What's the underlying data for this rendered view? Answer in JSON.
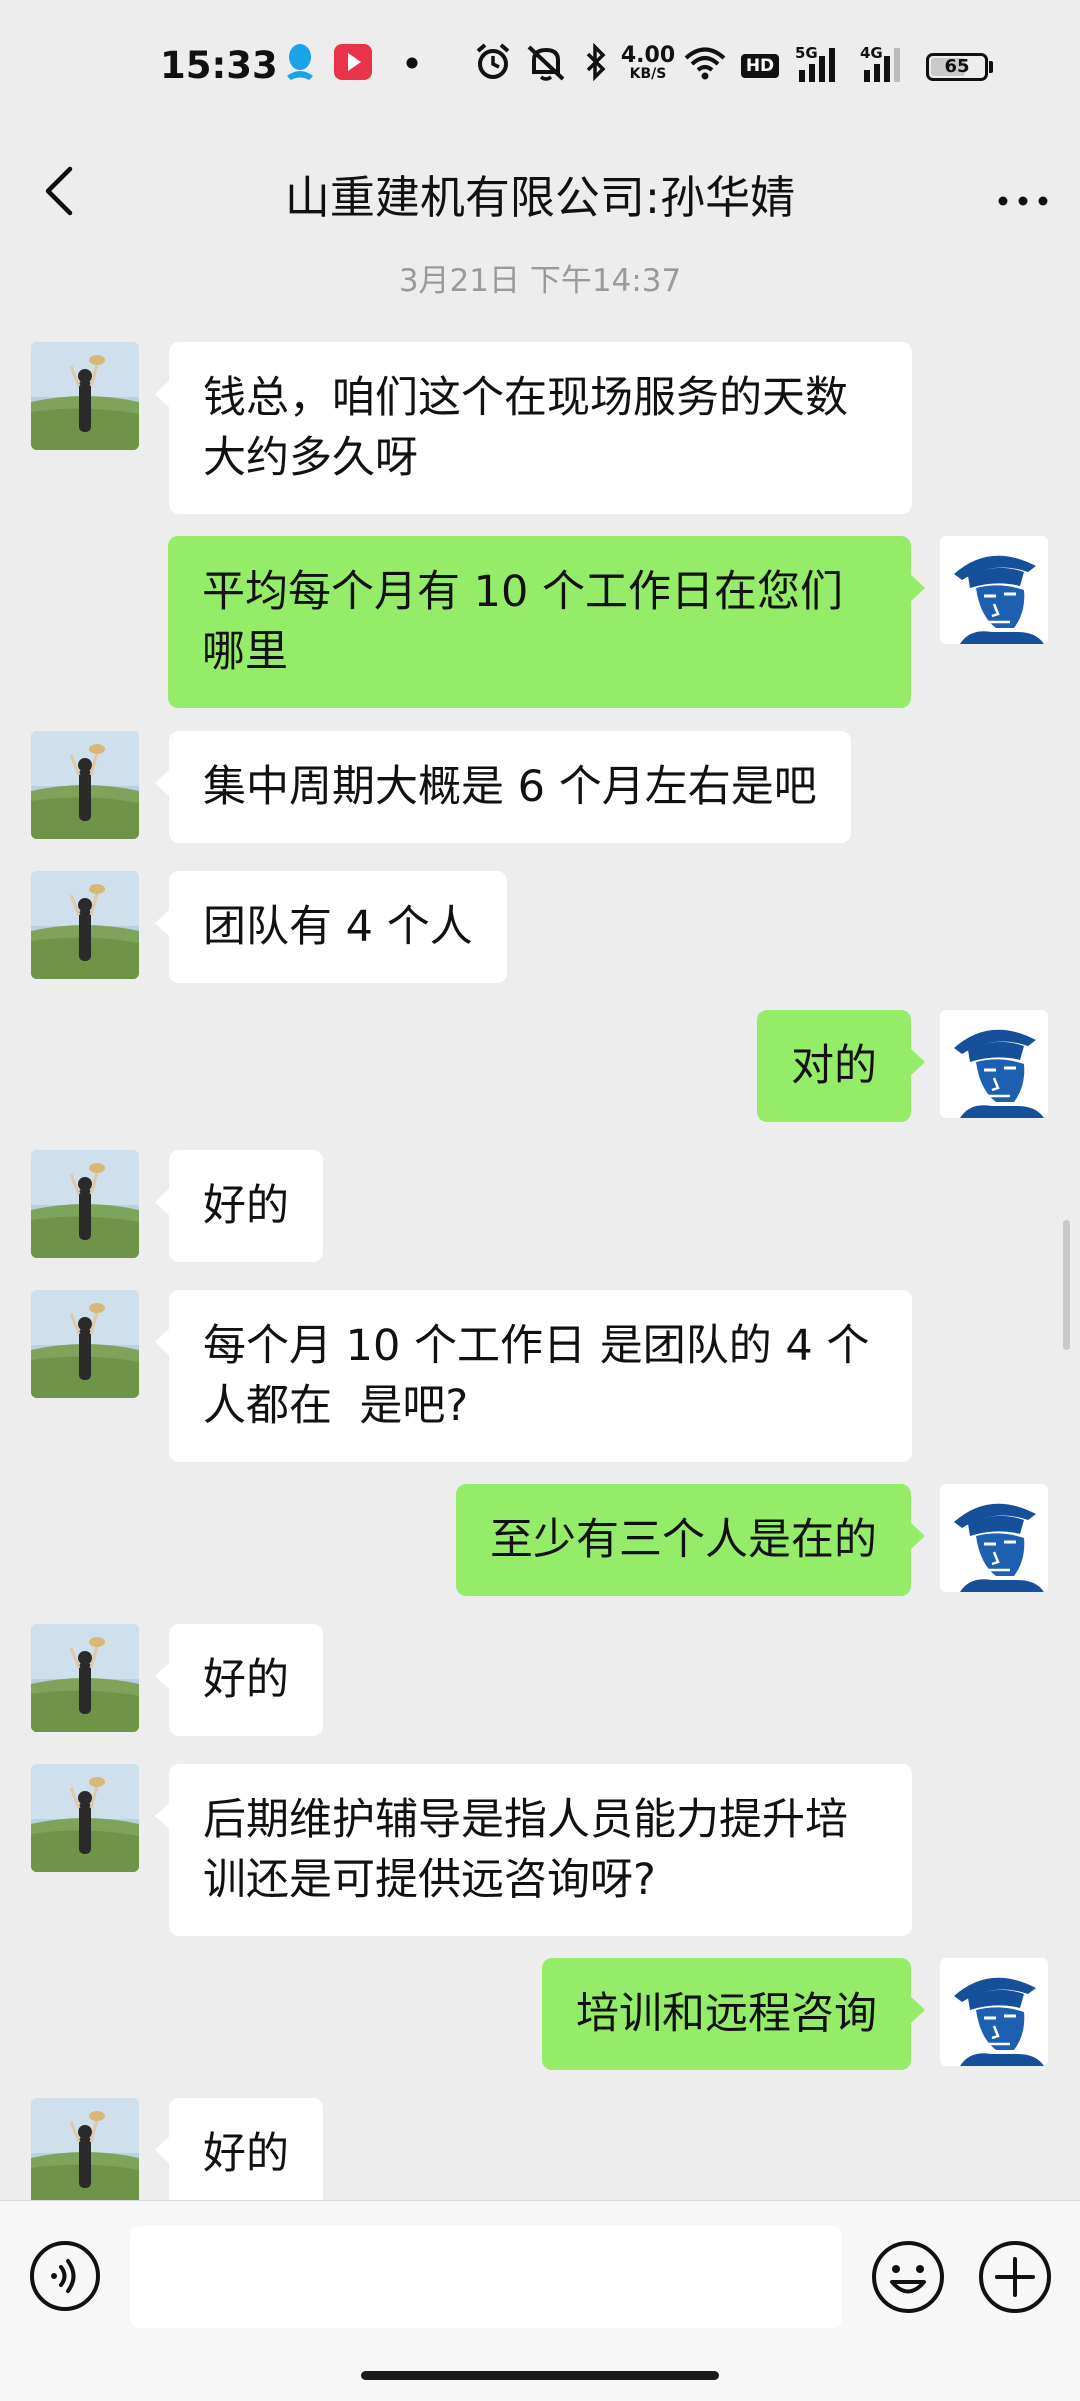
{
  "status_bar": {
    "time": "15:33",
    "net_speed_value": "4.00",
    "net_speed_unit": "KB/S",
    "hd_label": "HD",
    "signal1_label": "5G",
    "signal2_label": "4G",
    "battery_level": "65"
  },
  "header": {
    "title": "山重建机有限公司:孙华婧"
  },
  "timestamp": "3月21日 下午14:37",
  "messages": [
    {
      "side": "in",
      "text": "钱总，咱们这个在现场服务的天数大约多久呀"
    },
    {
      "side": "out",
      "text": "平均每个月有 10 个工作日在您们哪里"
    },
    {
      "side": "in",
      "text": "集中周期大概是 6 个月左右是吧"
    },
    {
      "side": "in",
      "text": "团队有 4 个人"
    },
    {
      "side": "out",
      "text": "对的"
    },
    {
      "side": "in",
      "text": "好的"
    },
    {
      "side": "in",
      "text": "每个月 10 个工作日 是团队的 4 个人都在  是吧?"
    },
    {
      "side": "out",
      "text": "至少有三个人是在的"
    },
    {
      "side": "in",
      "text": "好的"
    },
    {
      "side": "in",
      "text": "后期维护辅导是指人员能力提升培训还是可提供远咨询呀?"
    },
    {
      "side": "out",
      "text": "培训和远程咨询"
    },
    {
      "side": "in",
      "text": "好的"
    }
  ],
  "input": {
    "value": "",
    "placeholder": ""
  },
  "colors": {
    "background": "#ededed",
    "outgoing_bubble": "#95ec69",
    "incoming_bubble": "#ffffff",
    "timestamp_text": "#9a9a9a"
  },
  "icons": {
    "back": "chevron-left-icon",
    "more": "more-dots-icon",
    "voice": "voice-icon",
    "emoji": "emoji-icon",
    "plus": "plus-icon"
  }
}
